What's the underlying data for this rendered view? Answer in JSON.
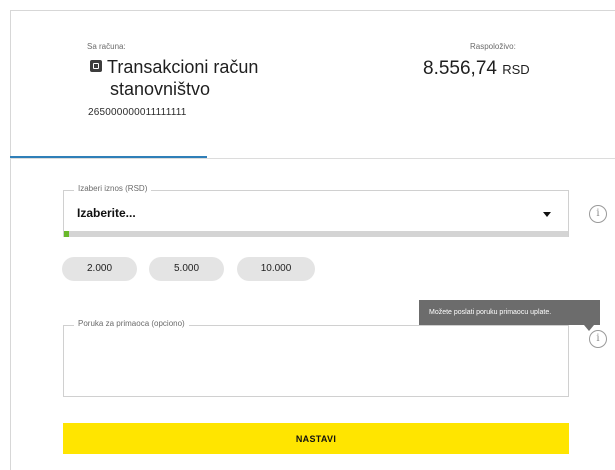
{
  "account": {
    "from_label": "Sa računa:",
    "name_line1": "Transakcioni račun",
    "name_line2": "stanovništvo",
    "number": "265000000011111111",
    "icon": "account-card-icon"
  },
  "balance": {
    "label": "Raspoloživo:",
    "amount": "8.556,74",
    "currency": "RSD"
  },
  "amount_select": {
    "legend": "Izaberi iznos (RSD)",
    "selected_value": "Izaberite...",
    "progress_fraction": 0.01,
    "progress_color": "#69b82a"
  },
  "quick_amounts": [
    "2.000",
    "5.000",
    "10.000"
  ],
  "message": {
    "legend": "Poruka za primaoca (opciono)",
    "value": ""
  },
  "tooltip": {
    "text": "Možete poslati poruku primaocu uplate."
  },
  "actions": {
    "continue_label": "NASTAVI"
  },
  "colors": {
    "accent": "#ffe500",
    "tab_indicator": "#2f7fb8"
  }
}
